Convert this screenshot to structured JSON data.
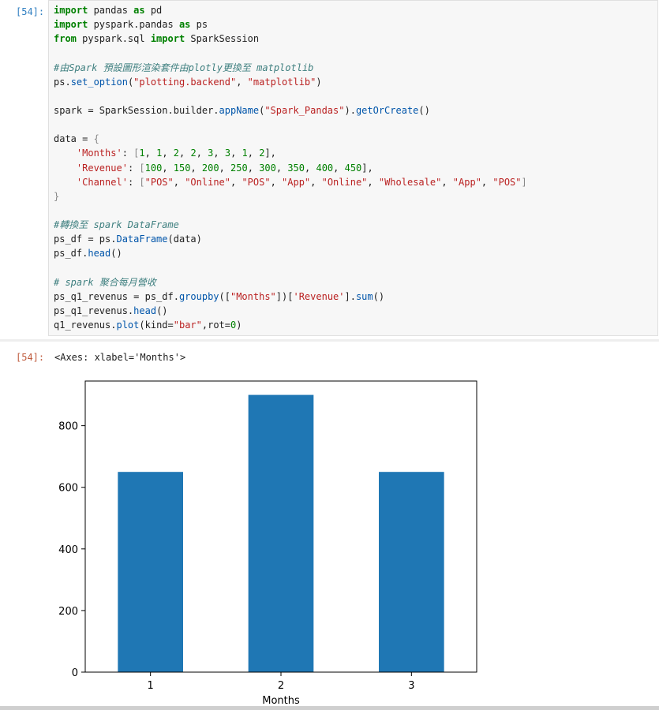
{
  "input_cell": {
    "prompt": "[54]:",
    "code_lines": [
      [
        {
          "t": "import",
          "c": "kw"
        },
        {
          "t": " pandas "
        },
        {
          "t": "as",
          "c": "kw"
        },
        {
          "t": " pd"
        }
      ],
      [
        {
          "t": "import",
          "c": "kw"
        },
        {
          "t": " pyspark.pandas "
        },
        {
          "t": "as",
          "c": "kw"
        },
        {
          "t": " ps"
        }
      ],
      [
        {
          "t": "from",
          "c": "kw"
        },
        {
          "t": " pyspark.sql "
        },
        {
          "t": "import",
          "c": "kw"
        },
        {
          "t": " SparkSession"
        }
      ],
      [],
      [
        {
          "t": "#由Spark 預設圖形渲染套件由plotly更換至 matplotlib",
          "c": "cm"
        }
      ],
      [
        {
          "t": "ps."
        },
        {
          "t": "set_option",
          "c": "fn"
        },
        {
          "t": "("
        },
        {
          "t": "\"plotting.backend\"",
          "c": "str"
        },
        {
          "t": ", "
        },
        {
          "t": "\"matplotlib\"",
          "c": "str"
        },
        {
          "t": ")"
        }
      ],
      [],
      [
        {
          "t": "spark = SparkSession.builder."
        },
        {
          "t": "appName",
          "c": "fn"
        },
        {
          "t": "("
        },
        {
          "t": "\"Spark_Pandas\"",
          "c": "str"
        },
        {
          "t": ")."
        },
        {
          "t": "getOrCreate",
          "c": "fn"
        },
        {
          "t": "()"
        }
      ],
      [],
      [
        {
          "t": "data = "
        },
        {
          "t": "{",
          "c": "br"
        }
      ],
      [
        {
          "t": "    "
        },
        {
          "t": "'Months'",
          "c": "str"
        },
        {
          "t": ": "
        },
        {
          "t": "[",
          "c": "br"
        },
        {
          "t": "1",
          "c": "num"
        },
        {
          "t": ", "
        },
        {
          "t": "1",
          "c": "num"
        },
        {
          "t": ", "
        },
        {
          "t": "2",
          "c": "num"
        },
        {
          "t": ", "
        },
        {
          "t": "2",
          "c": "num"
        },
        {
          "t": ", "
        },
        {
          "t": "3",
          "c": "num"
        },
        {
          "t": ", "
        },
        {
          "t": "3",
          "c": "num"
        },
        {
          "t": ", "
        },
        {
          "t": "1",
          "c": "num"
        },
        {
          "t": ", "
        },
        {
          "t": "2",
          "c": "num"
        },
        {
          "t": "],"
        }
      ],
      [
        {
          "t": "    "
        },
        {
          "t": "'Revenue'",
          "c": "str"
        },
        {
          "t": ": "
        },
        {
          "t": "[",
          "c": "br"
        },
        {
          "t": "100",
          "c": "num"
        },
        {
          "t": ", "
        },
        {
          "t": "150",
          "c": "num"
        },
        {
          "t": ", "
        },
        {
          "t": "200",
          "c": "num"
        },
        {
          "t": ", "
        },
        {
          "t": "250",
          "c": "num"
        },
        {
          "t": ", "
        },
        {
          "t": "300",
          "c": "num"
        },
        {
          "t": ", "
        },
        {
          "t": "350",
          "c": "num"
        },
        {
          "t": ", "
        },
        {
          "t": "400",
          "c": "num"
        },
        {
          "t": ", "
        },
        {
          "t": "450",
          "c": "num"
        },
        {
          "t": "],"
        }
      ],
      [
        {
          "t": "    "
        },
        {
          "t": "'Channel'",
          "c": "str"
        },
        {
          "t": ": "
        },
        {
          "t": "[",
          "c": "br"
        },
        {
          "t": "\"POS\"",
          "c": "str"
        },
        {
          "t": ", "
        },
        {
          "t": "\"Online\"",
          "c": "str"
        },
        {
          "t": ", "
        },
        {
          "t": "\"POS\"",
          "c": "str"
        },
        {
          "t": ", "
        },
        {
          "t": "\"App\"",
          "c": "str"
        },
        {
          "t": ", "
        },
        {
          "t": "\"Online\"",
          "c": "str"
        },
        {
          "t": ", "
        },
        {
          "t": "\"Wholesale\"",
          "c": "str"
        },
        {
          "t": ", "
        },
        {
          "t": "\"App\"",
          "c": "str"
        },
        {
          "t": ", "
        },
        {
          "t": "\"POS\"",
          "c": "str"
        },
        {
          "t": "]",
          "c": "br"
        }
      ],
      [
        {
          "t": "}",
          "c": "br"
        }
      ],
      [],
      [
        {
          "t": "#轉換至 spark DataFrame",
          "c": "cm"
        }
      ],
      [
        {
          "t": "ps_df = ps."
        },
        {
          "t": "DataFrame",
          "c": "fn"
        },
        {
          "t": "(data)"
        }
      ],
      [
        {
          "t": "ps_df."
        },
        {
          "t": "head",
          "c": "fn"
        },
        {
          "t": "()"
        }
      ],
      [],
      [
        {
          "t": "# spark 聚合每月營收",
          "c": "cm"
        }
      ],
      [
        {
          "t": "ps_q1_revenus = ps_df."
        },
        {
          "t": "groupby",
          "c": "fn"
        },
        {
          "t": "(["
        },
        {
          "t": "\"Months\"",
          "c": "str"
        },
        {
          "t": "])["
        },
        {
          "t": "'Revenue'",
          "c": "str"
        },
        {
          "t": "]."
        },
        {
          "t": "sum",
          "c": "fn"
        },
        {
          "t": "()"
        }
      ],
      [
        {
          "t": "ps_q1_revenus."
        },
        {
          "t": "head",
          "c": "fn"
        },
        {
          "t": "()"
        }
      ],
      [
        {
          "t": "q1_revenus."
        },
        {
          "t": "plot",
          "c": "fn"
        },
        {
          "t": "(kind="
        },
        {
          "t": "\"bar\"",
          "c": "str"
        },
        {
          "t": ",rot="
        },
        {
          "t": "0",
          "c": "num"
        },
        {
          "t": ")"
        }
      ]
    ]
  },
  "output_cell": {
    "prompt": "[54]:",
    "repr_text": "<Axes: xlabel='Months'>"
  },
  "colors": {
    "bar": "#1f77b4",
    "code_bg": "#f7f7f7",
    "in_prompt": "#307fc1",
    "out_prompt": "#bf5b3d"
  },
  "chart_data": {
    "type": "bar",
    "categories": [
      "1",
      "2",
      "3"
    ],
    "values": [
      650,
      900,
      650
    ],
    "xlabel": "Months",
    "ylabel": "",
    "ylim": [
      0,
      945
    ],
    "yticks": [
      0,
      200,
      400,
      600,
      800
    ],
    "grid": false,
    "legend": false
  }
}
